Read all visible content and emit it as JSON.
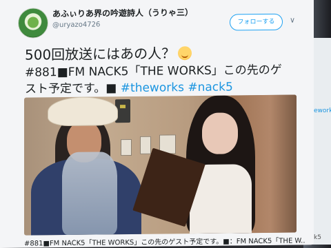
{
  "user": {
    "display_name": "あふぃりあ界の吟遊詩人（うりゃ三）",
    "handle": "@uryazo4726"
  },
  "follow_label": "フォローする",
  "tweet": {
    "line1": "500回放送にはあの人？",
    "line2": "#881■FM NACK5「THE WORKS」この先のゲ",
    "line3_text": "スト予定です。■",
    "hashtags": [
      "#theworks",
      "#nack5"
    ]
  },
  "photo_caption": "#881■FM NACK5「THE WORKS」この先のゲスト予定です。■：FM NACK5「THE W..",
  "background": {
    "tweet_fragment": "eworks",
    "footer_fragment": "k5"
  },
  "colors": {
    "link": "#1b95e0",
    "follow_border": "#1da1f2",
    "text": "#1c2022",
    "muted": "#657786"
  },
  "icons": {
    "chevron": "chevron-down-icon",
    "emoji": "smiling-face-icon"
  }
}
